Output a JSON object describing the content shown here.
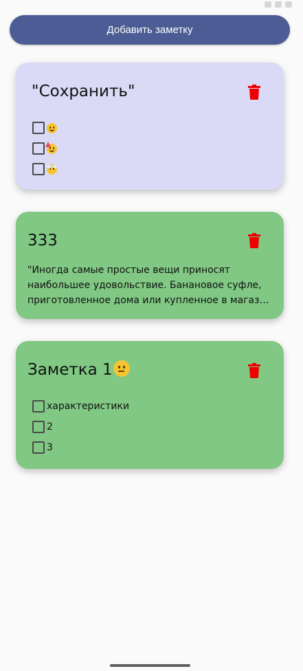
{
  "header": {
    "add_button_label": "Добавить заметку"
  },
  "notes": [
    {
      "title": "\"Сохранить\"",
      "background": "#dad9f6",
      "checklist": [
        {
          "text": "",
          "emoji": "smiling-face-icon"
        },
        {
          "text": "",
          "emoji": "partying-face-icon"
        },
        {
          "text": "",
          "emoji": "face-in-clouds-icon"
        }
      ]
    },
    {
      "title": "333",
      "background": "#80c883",
      "text_lines": [
        "\"Иногда самые простые вещи приносят",
        "наибольшее удовольствие. Банановое суфле,",
        "приготовленное дома или купленное в магазин…"
      ]
    },
    {
      "title": "Заметка 1",
      "title_emoji": "neutral-face-icon",
      "background": "#80c883",
      "checklist": [
        {
          "text": "характеристики"
        },
        {
          "text": "2"
        },
        {
          "text": "3"
        }
      ]
    }
  ],
  "colors": {
    "accent": "#4b5d94",
    "delete": "#ee0000"
  }
}
